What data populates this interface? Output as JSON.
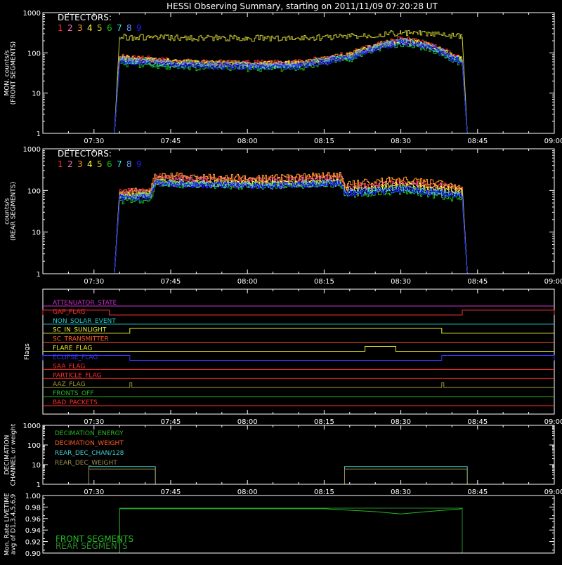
{
  "title": "HESSI Observing Summary, starting on 2011/11/09 07:20:28 UT",
  "colors": {
    "background": "#000000",
    "axes": "#ffffff",
    "det": [
      "#ff2d2d",
      "#ff69b4",
      "#ff9a2e",
      "#ffff33",
      "#c8c832",
      "#19c219",
      "#2ee6e6",
      "#6699ff",
      "#1a1aff"
    ],
    "flags": {
      "ATTENUATOR_STATE": "#cc33cc",
      "GAP_FLAG": "#ff3030",
      "NON_SOLAR_EVENT": "#22cccc",
      "SC_IN_SUNLIGHT": "#eeee33",
      "SC_TRANSMITTER": "#ff5a2a",
      "FLARE_FLAG": "#eeee22",
      "ECLIPSE_FLAG": "#3333ff",
      "SAA_FLAG": "#ff3030",
      "PARTICLE_FLAG": "#ff3030",
      "AAZ_FLAG": "#999933",
      "FRONTS_OFF": "#22bb22",
      "BAD_PACKETS": "#ff3030"
    },
    "decimation": [
      "#22bb22",
      "#ff5a2a",
      "#44cccc",
      "#a09050"
    ],
    "livetime": [
      "#22bb22",
      "#2a8a2a"
    ]
  },
  "chart_data": [
    {
      "type": "line",
      "id": "front",
      "ylabel": [
        "MON. counts/s",
        "(FRONT SEGMENTS)"
      ],
      "y_scale": "log",
      "ylim": [
        1,
        1000
      ],
      "y_ticks": [
        "1",
        "10",
        "100",
        "1000"
      ],
      "xlim": [
        "07:20",
        "09:00"
      ],
      "x_ticks": [
        "07:30",
        "07:45",
        "08:00",
        "08:15",
        "08:30",
        "08:45",
        "09:00"
      ],
      "legend_title": "DETECTORS:",
      "legend_labels": [
        "1",
        "2",
        "3",
        "4",
        "5",
        "6",
        "7",
        "8",
        "9"
      ],
      "legend_placement": "top-left",
      "series": [
        {
          "label": "1",
          "x": [
            "07:20",
            "07:34",
            "07:35",
            "07:45",
            "08:00",
            "08:10",
            "08:20",
            "08:30",
            "08:35",
            "08:40",
            "08:42",
            "08:43",
            "09:00"
          ],
          "y": [
            1,
            1,
            80,
            62,
            55,
            57,
            92,
            220,
            170,
            85,
            70,
            1,
            1
          ]
        },
        {
          "label": "2",
          "x": [
            "07:20",
            "07:34",
            "07:35",
            "07:45",
            "08:00",
            "08:10",
            "08:20",
            "08:30",
            "08:35",
            "08:40",
            "08:42",
            "08:43",
            "09:00"
          ],
          "y": [
            1,
            1,
            70,
            56,
            50,
            52,
            82,
            200,
            155,
            78,
            65,
            1,
            1
          ]
        },
        {
          "label": "3",
          "x": [
            "07:20",
            "07:34",
            "07:35",
            "07:45",
            "08:00",
            "08:10",
            "08:20",
            "08:30",
            "08:35",
            "08:40",
            "08:42",
            "08:43",
            "09:00"
          ],
          "y": [
            1,
            1,
            75,
            60,
            52,
            55,
            88,
            210,
            160,
            80,
            66,
            1,
            1
          ]
        },
        {
          "label": "4",
          "x": [
            "07:20",
            "07:34",
            "07:35",
            "07:45",
            "08:00",
            "08:10",
            "08:20",
            "08:30",
            "08:35",
            "08:40",
            "08:42",
            "08:43",
            "09:00"
          ],
          "y": [
            1,
            1,
            72,
            58,
            50,
            53,
            85,
            205,
            158,
            79,
            64,
            1,
            1
          ]
        },
        {
          "label": "5",
          "x": [
            "07:20",
            "07:34",
            "07:35",
            "07:45",
            "08:00",
            "08:10",
            "08:20",
            "08:30",
            "08:35",
            "08:40",
            "08:42",
            "08:43",
            "09:00"
          ],
          "y": [
            1,
            1,
            250,
            235,
            230,
            232,
            260,
            310,
            300,
            260,
            250,
            1,
            1
          ]
        },
        {
          "label": "6",
          "x": [
            "07:20",
            "07:34",
            "07:35",
            "07:45",
            "08:00",
            "08:10",
            "08:20",
            "08:30",
            "08:35",
            "08:40",
            "08:42",
            "08:43",
            "09:00"
          ],
          "y": [
            1,
            1,
            55,
            44,
            40,
            42,
            70,
            170,
            130,
            65,
            55,
            1,
            1
          ]
        },
        {
          "label": "7",
          "x": [
            "07:20",
            "07:34",
            "07:35",
            "07:45",
            "08:00",
            "08:10",
            "08:20",
            "08:30",
            "08:35",
            "08:40",
            "08:42",
            "08:43",
            "09:00"
          ],
          "y": [
            1,
            1,
            65,
            52,
            46,
            48,
            78,
            190,
            150,
            74,
            62,
            1,
            1
          ]
        },
        {
          "label": "8",
          "x": [
            "07:20",
            "07:34",
            "07:35",
            "07:45",
            "08:00",
            "08:10",
            "08:20",
            "08:30",
            "08:35",
            "08:40",
            "08:42",
            "08:43",
            "09:00"
          ],
          "y": [
            1,
            1,
            68,
            54,
            48,
            50,
            80,
            195,
            152,
            76,
            63,
            1,
            1
          ]
        },
        {
          "label": "9",
          "x": [
            "07:20",
            "07:34",
            "07:35",
            "07:45",
            "08:00",
            "08:10",
            "08:20",
            "08:30",
            "08:35",
            "08:40",
            "08:42",
            "08:43",
            "09:00"
          ],
          "y": [
            1,
            1,
            60,
            50,
            44,
            46,
            75,
            180,
            140,
            70,
            60,
            1,
            1
          ]
        }
      ]
    },
    {
      "type": "line",
      "id": "rear",
      "ylabel": [
        "counts/s",
        "(REAR SEGMENTS)"
      ],
      "y_scale": "log",
      "ylim": [
        1,
        1000
      ],
      "y_ticks": [
        "1",
        "10",
        "100",
        "1000"
      ],
      "xlim": [
        "07:20",
        "09:00"
      ],
      "x_ticks": [
        "07:30",
        "07:45",
        "08:00",
        "08:15",
        "08:30",
        "08:45",
        "09:00"
      ],
      "legend_title": "DETECTORS:",
      "legend_labels": [
        "1",
        "2",
        "3",
        "4",
        "5",
        "6",
        "7",
        "8",
        "9"
      ],
      "legend_placement": "top-left",
      "series": [
        {
          "label": "1",
          "x": [
            "07:20",
            "07:34",
            "07:35",
            "07:41",
            "07:42",
            "07:50",
            "08:05",
            "08:18",
            "08:19",
            "08:30",
            "08:42",
            "08:43",
            "09:00"
          ],
          "y": [
            1,
            1,
            95,
            100,
            215,
            190,
            180,
            220,
            120,
            160,
            115,
            1,
            1
          ]
        },
        {
          "label": "2",
          "x": [
            "07:20",
            "07:34",
            "07:35",
            "07:41",
            "07:42",
            "07:50",
            "08:05",
            "08:18",
            "08:19",
            "08:30",
            "08:42",
            "08:43",
            "09:00"
          ],
          "y": [
            1,
            1,
            90,
            95,
            200,
            180,
            170,
            205,
            115,
            150,
            110,
            1,
            1
          ]
        },
        {
          "label": "3",
          "x": [
            "07:20",
            "07:34",
            "07:35",
            "07:41",
            "07:42",
            "07:50",
            "08:05",
            "08:18",
            "08:19",
            "08:30",
            "08:42",
            "08:43",
            "09:00"
          ],
          "y": [
            1,
            1,
            92,
            98,
            240,
            210,
            200,
            240,
            140,
            190,
            125,
            1,
            1
          ]
        },
        {
          "label": "4",
          "x": [
            "07:20",
            "07:34",
            "07:35",
            "07:41",
            "07:42",
            "07:50",
            "08:05",
            "08:18",
            "08:19",
            "08:30",
            "08:42",
            "08:43",
            "09:00"
          ],
          "y": [
            1,
            1,
            80,
            85,
            165,
            150,
            145,
            160,
            100,
            135,
            95,
            1,
            1
          ]
        },
        {
          "label": "5",
          "x": [
            "07:20",
            "07:34",
            "07:35",
            "07:41",
            "07:42",
            "07:50",
            "08:05",
            "08:18",
            "08:19",
            "08:30",
            "08:42",
            "08:43",
            "09:00"
          ],
          "y": [
            1,
            1,
            75,
            80,
            160,
            145,
            140,
            150,
            95,
            120,
            85,
            1,
            1
          ]
        },
        {
          "label": "6",
          "x": [
            "07:20",
            "07:34",
            "07:35",
            "07:41",
            "07:42",
            "07:50",
            "08:05",
            "08:18",
            "08:19",
            "08:30",
            "08:42",
            "08:43",
            "09:00"
          ],
          "y": [
            1,
            1,
            55,
            58,
            145,
            130,
            125,
            140,
            75,
            95,
            60,
            1,
            1
          ]
        },
        {
          "label": "7",
          "x": [
            "07:20",
            "07:34",
            "07:35",
            "07:41",
            "07:42",
            "07:50",
            "08:05",
            "08:18",
            "08:19",
            "08:30",
            "08:42",
            "08:43",
            "09:00"
          ],
          "y": [
            1,
            1,
            70,
            74,
            155,
            140,
            135,
            150,
            85,
            110,
            75,
            1,
            1
          ]
        },
        {
          "label": "8",
          "x": [
            "07:20",
            "07:34",
            "07:35",
            "07:41",
            "07:42",
            "07:50",
            "08:05",
            "08:18",
            "08:19",
            "08:30",
            "08:42",
            "08:43",
            "09:00"
          ],
          "y": [
            1,
            1,
            72,
            76,
            150,
            138,
            130,
            148,
            88,
            112,
            78,
            1,
            1
          ]
        },
        {
          "label": "9",
          "x": [
            "07:20",
            "07:34",
            "07:35",
            "07:41",
            "07:42",
            "07:50",
            "08:05",
            "08:18",
            "08:19",
            "08:30",
            "08:42",
            "08:43",
            "09:00"
          ],
          "y": [
            1,
            1,
            65,
            70,
            150,
            135,
            128,
            145,
            82,
            105,
            72,
            1,
            1
          ]
        }
      ]
    },
    {
      "type": "line",
      "id": "flags",
      "ylabel": [
        "Flags"
      ],
      "xlim": [
        "07:20",
        "09:00"
      ],
      "x_ticks": [
        "07:30",
        "07:45",
        "08:00",
        "08:15",
        "08:30",
        "08:45",
        "09:00"
      ],
      "flags": [
        {
          "name": "ATTENUATOR_STATE",
          "on": []
        },
        {
          "name": "GAP_FLAG",
          "on": [
            [
              "07:20",
              "07:33"
            ],
            [
              "08:42",
              "09:00"
            ]
          ]
        },
        {
          "name": "NON_SOLAR_EVENT",
          "on": []
        },
        {
          "name": "SC_IN_SUNLIGHT",
          "on": [
            [
              "07:37",
              "08:38"
            ]
          ]
        },
        {
          "name": "SC_TRANSMITTER",
          "on": []
        },
        {
          "name": "FLARE_FLAG",
          "on": [
            [
              "08:23",
              "08:29"
            ]
          ]
        },
        {
          "name": "ECLIPSE_FLAG",
          "on": [
            [
              "07:20",
              "07:37"
            ],
            [
              "08:38",
              "09:00"
            ]
          ]
        },
        {
          "name": "SAA_FLAG",
          "on": []
        },
        {
          "name": "PARTICLE_FLAG",
          "on": []
        },
        {
          "name": "AAZ_FLAG",
          "on": [
            [
              "07:37",
              "07:37.4"
            ],
            [
              "08:38",
              "08:38.4"
            ]
          ]
        },
        {
          "name": "FRONTS_OFF",
          "on": []
        },
        {
          "name": "BAD_PACKETS",
          "on": []
        }
      ]
    },
    {
      "type": "line",
      "id": "decimation",
      "ylabel": [
        "DECIMATION",
        "CHANNEL or weight"
      ],
      "y_scale": "log",
      "ylim": [
        1,
        1000
      ],
      "y_ticks": [
        "1",
        "10",
        "100",
        "1000"
      ],
      "xlim": [
        "07:20",
        "09:00"
      ],
      "x_ticks": [
        "07:30",
        "07:45",
        "08:00",
        "08:15",
        "08:30",
        "08:45",
        "09:00"
      ],
      "legend_labels": [
        "DECIMATION_ENERGY",
        "DECIMATION_WEIGHT",
        "REAR_DEC_CHAN/128",
        "REAR_DEC_WEIGHT"
      ],
      "series": [
        {
          "label": "DECIMATION_ENERGY",
          "x": [
            "07:20",
            "09:00"
          ],
          "y": [
            1,
            1
          ]
        },
        {
          "label": "DECIMATION_WEIGHT",
          "x": [
            "07:20",
            "09:00"
          ],
          "y": [
            1,
            1
          ]
        },
        {
          "label": "REAR_DEC_CHAN/128",
          "x": [
            "07:20",
            "07:29",
            "07:29",
            "07:42",
            "07:42",
            "08:19",
            "08:19",
            "08:43",
            "08:43",
            "09:00"
          ],
          "y": [
            1,
            1,
            8,
            8,
            1,
            1,
            8,
            8,
            1,
            1
          ]
        },
        {
          "label": "REAR_DEC_WEIGHT",
          "x": [
            "07:20",
            "07:29",
            "07:29",
            "07:42",
            "07:42",
            "08:19",
            "08:19",
            "08:43",
            "08:43",
            "09:00"
          ],
          "y": [
            1,
            1,
            6,
            6,
            1,
            1,
            6,
            6,
            1,
            1
          ]
        }
      ]
    },
    {
      "type": "line",
      "id": "livetime",
      "ylabel": [
        "Mon. Rate LIVETIME",
        "avg of D1,3,4,5,6,9"
      ],
      "ylim": [
        0.9,
        1.0
      ],
      "y_ticks": [
        "0.90",
        "0.92",
        "0.94",
        "0.96",
        "0.98",
        "1.00"
      ],
      "legend_labels": [
        "FRONT SEGMENTS",
        "REAR SEGMENTS"
      ],
      "series": [
        {
          "label": "FRONT SEGMENTS",
          "x": [
            "07:20",
            "07:35",
            "07:35",
            "08:00",
            "08:15",
            "08:25",
            "08:30",
            "08:35",
            "08:42",
            "08:42",
            "09:00"
          ],
          "y": [
            0.9,
            0.9,
            0.977,
            0.977,
            0.977,
            0.972,
            0.968,
            0.972,
            0.977,
            0.9,
            0.9
          ]
        },
        {
          "label": "REAR SEGMENTS",
          "x": [
            "07:20",
            "07:35",
            "07:35",
            "08:42",
            "08:42",
            "09:00"
          ],
          "y": [
            0.9,
            0.9,
            0.978,
            0.978,
            0.9,
            0.9
          ]
        }
      ]
    }
  ]
}
